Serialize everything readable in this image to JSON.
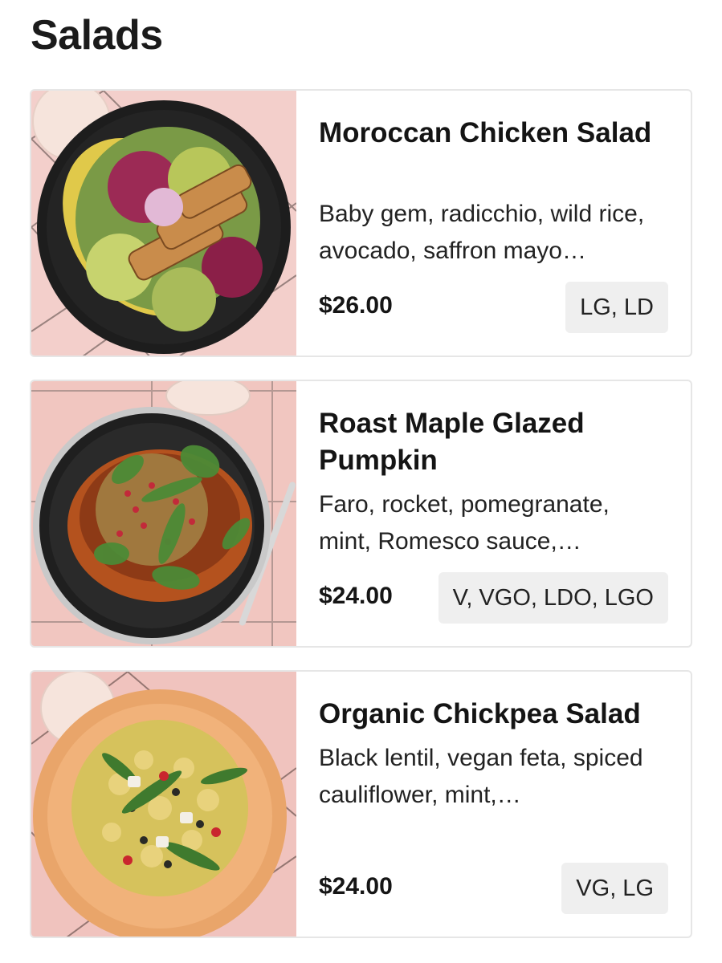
{
  "page": {
    "title": "Salads"
  },
  "items": [
    {
      "name": "Moroccan Chicken Salad",
      "description": "Baby gem, radicchio, wild rice, avocado, saffron mayo…",
      "price": "$26.00",
      "tags": "LG, LD",
      "image": "moroccan-chicken-salad-photo"
    },
    {
      "name": "Roast Maple Glazed Pumpkin",
      "description": "Faro, rocket, pomegranate, mint, Romesco sauce,…",
      "price": "$24.00",
      "tags": "V, VGO, LDO, LGO",
      "image": "roast-pumpkin-photo"
    },
    {
      "name": "Organic Chickpea Salad",
      "description": "Black lentil, vegan feta, spiced cauliflower, mint,…",
      "price": "$24.00",
      "tags": "VG, LG",
      "image": "chickpea-salad-photo"
    }
  ]
}
